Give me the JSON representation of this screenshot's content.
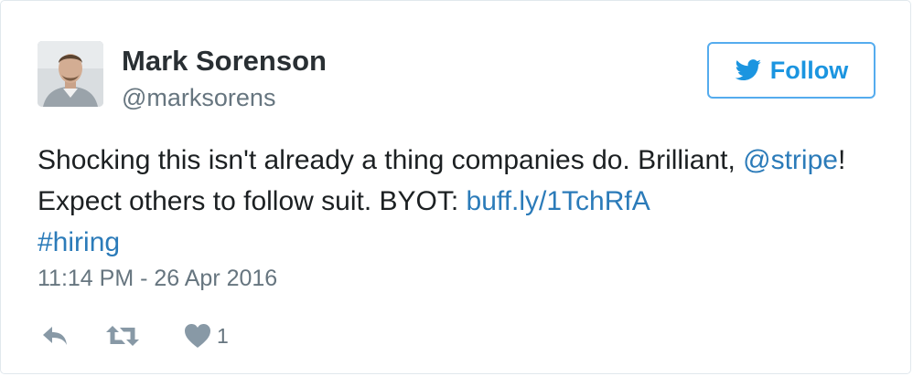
{
  "tweet": {
    "author": {
      "display_name": "Mark Sorenson",
      "handle": "@marksorens"
    },
    "follow_button": {
      "label": "Follow",
      "icon": "twitter-bird-icon"
    },
    "text_parts": [
      "Shocking this isn't already a thing companies do. Brilliant, ",
      "@stripe",
      "! Expect others to follow suit. BYOT: ",
      "buff.ly/1TchRfA",
      " ",
      "#hiring"
    ],
    "timestamp": "11:14 PM - 26 Apr 2016",
    "actions": {
      "reply_icon": "reply-icon",
      "retweet_icon": "retweet-icon",
      "like_icon": "heart-icon",
      "like_count": "1"
    },
    "colors": {
      "link": "#2b7bb9",
      "twitter_blue": "#55acee",
      "text": "#1c2022",
      "secondary": "#66757f",
      "action_icon": "#8899a6"
    }
  }
}
